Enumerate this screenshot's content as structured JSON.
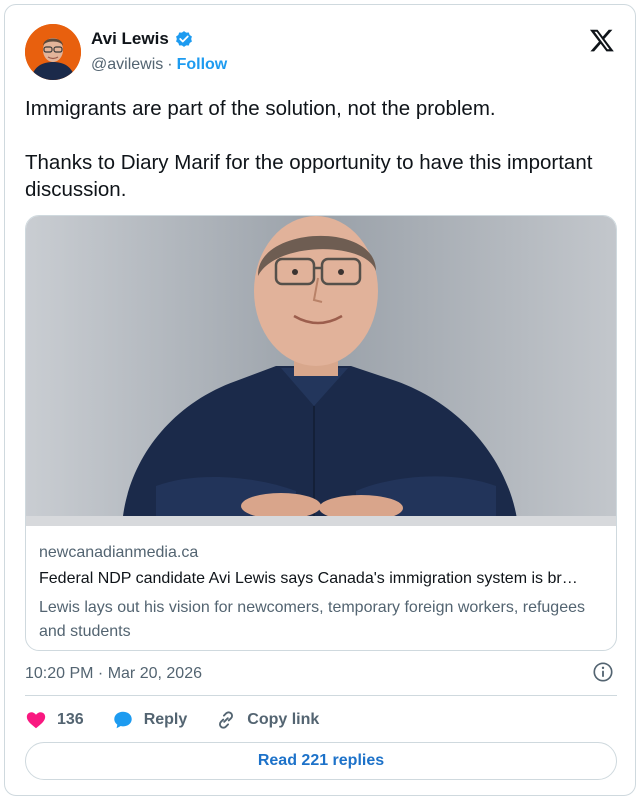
{
  "author": {
    "name": "Avi Lewis",
    "handle": "@avilewis",
    "separator": "·",
    "follow_label": "Follow"
  },
  "tweet": {
    "text": "Immigrants are part of the solution, not the problem.\n\nThanks to Diary Marif for the opportunity to have this important discussion."
  },
  "link_card": {
    "domain": "newcanadianmedia.ca",
    "title": "Federal NDP candidate Avi Lewis says Canada's immigration system is br…",
    "description": "Lewis lays out his vision for newcomers, temporary foreign workers, refugees and students"
  },
  "meta": {
    "timestamp": "10:20 PM · Mar 20, 2026"
  },
  "actions": {
    "likes": "136",
    "reply_label": "Reply",
    "copy_link_label": "Copy link"
  },
  "read_replies_label": "Read 221 replies",
  "icons": {
    "verified": "verified-badge-icon",
    "x_logo": "x-logo-icon",
    "info": "info-icon",
    "heart": "heart-icon",
    "reply": "reply-bubble-icon",
    "link": "link-icon"
  },
  "colors": {
    "accent_blue": "#1d9bf0",
    "like_pink": "#f91880",
    "text_primary": "#0f1419",
    "text_secondary": "#536471",
    "border": "#cfd9de",
    "avatar_bg": "#e8600e",
    "shirt_navy": "#1b2a4a"
  }
}
